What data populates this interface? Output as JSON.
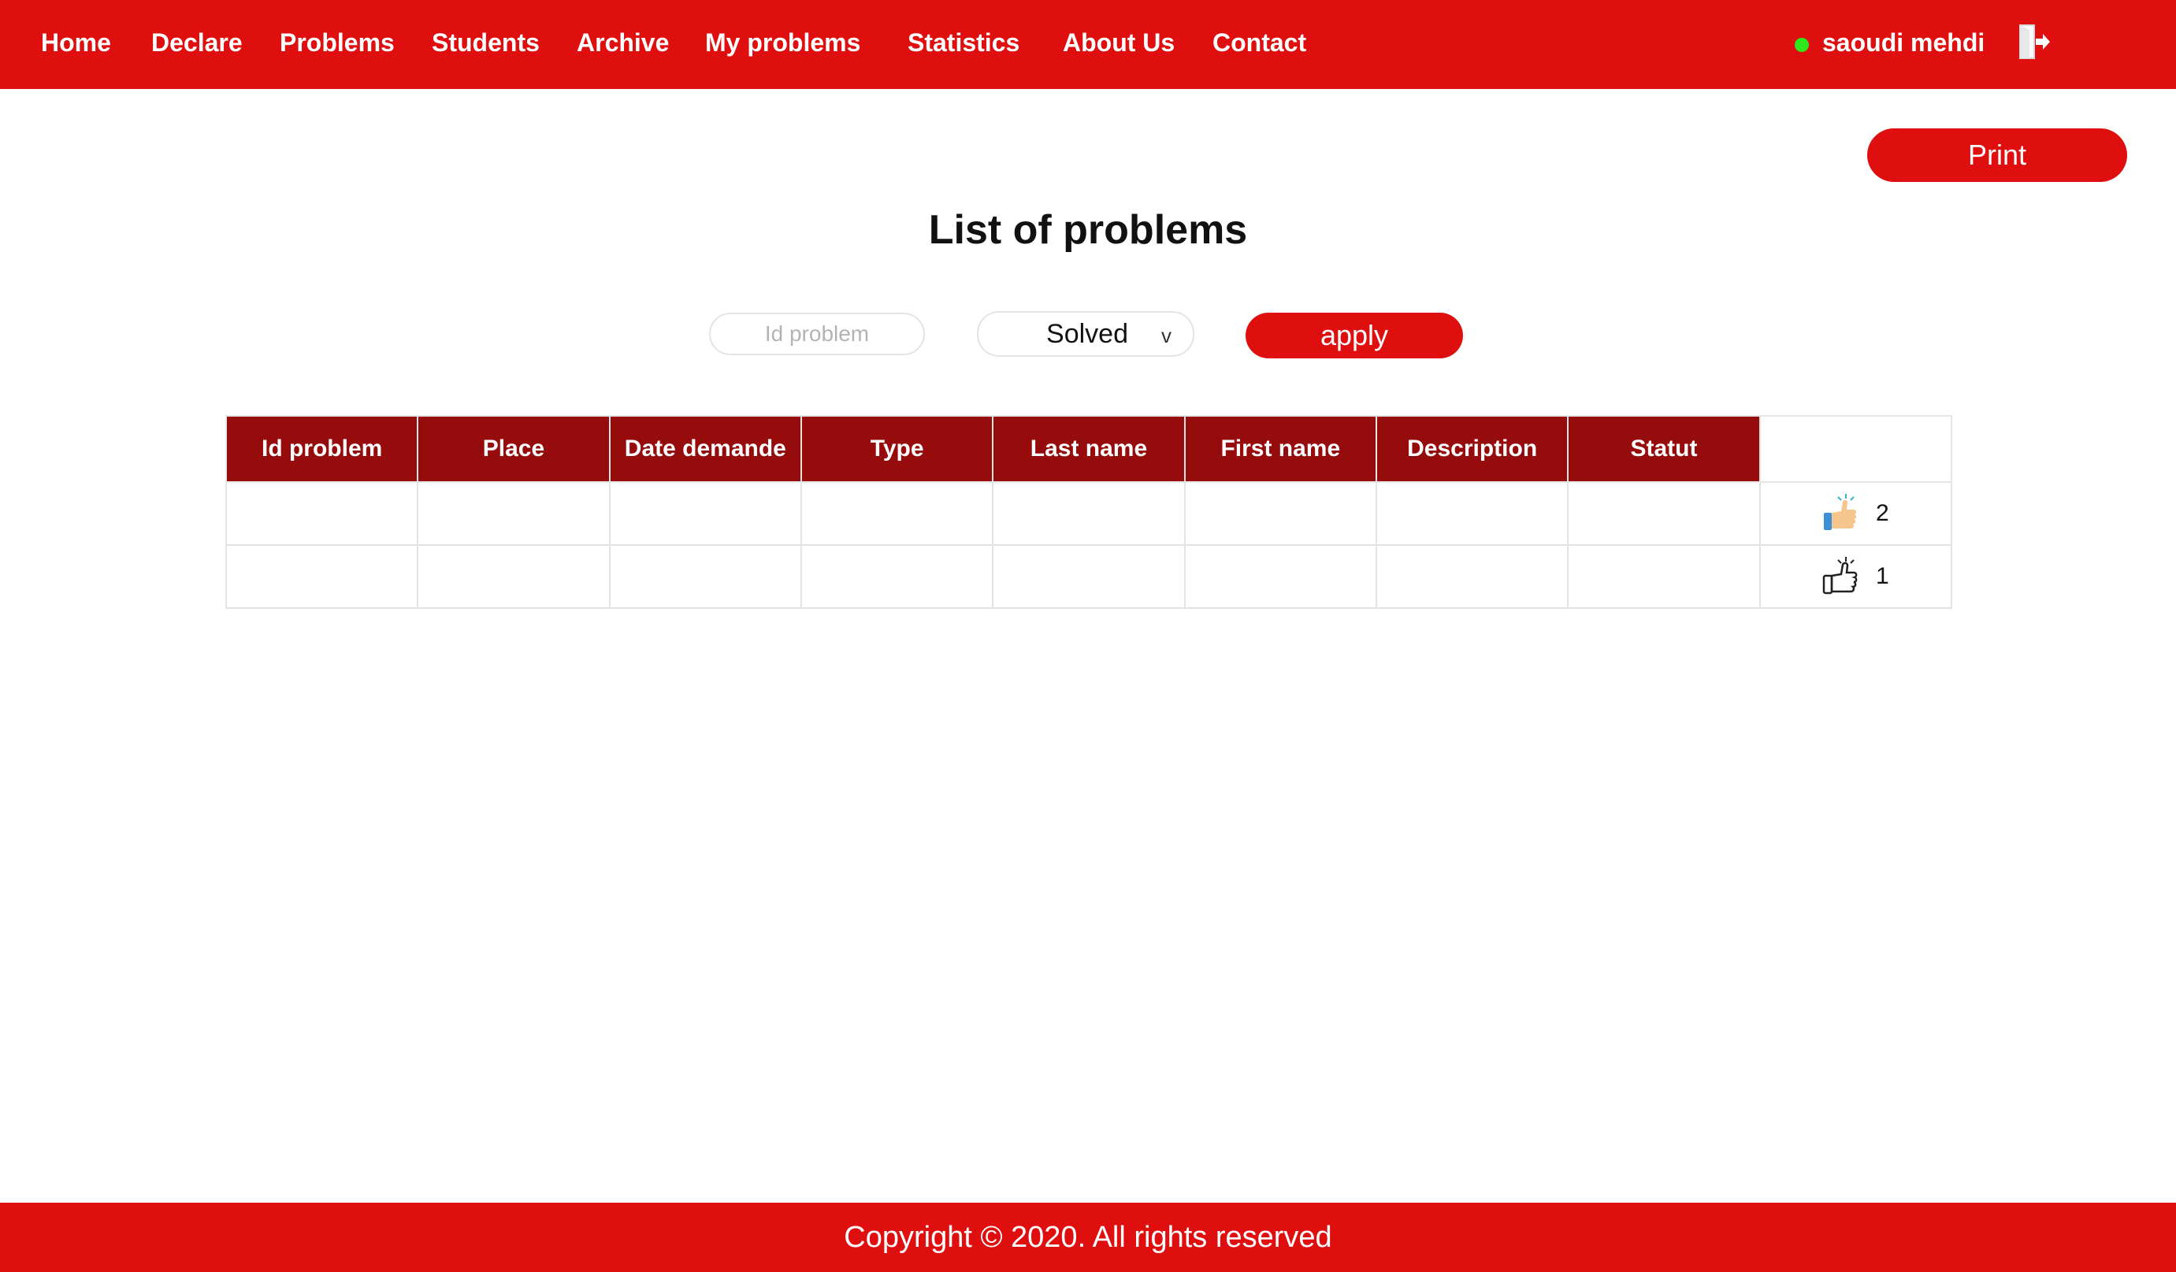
{
  "nav": {
    "items": [
      "Home",
      "Declare",
      "Problems",
      "Students",
      "Archive",
      "My problems",
      "Statistics",
      "About Us",
      "Contact"
    ],
    "user_name": "saoudi mehdi",
    "online_color": "#2ee81e",
    "logout_icon": "logout-icon"
  },
  "toolbar": {
    "print_label": "Print"
  },
  "page": {
    "title": "List of problems"
  },
  "filter": {
    "id_placeholder": "Id problem",
    "status_selected": "Solved",
    "apply_label": "apply"
  },
  "table": {
    "columns": [
      "Id problem",
      "Place",
      "Date demande",
      "Type",
      "Last name",
      "First name",
      "Description",
      "Statut"
    ],
    "rows": [
      {
        "cells": [
          "",
          "",
          "",
          "",
          "",
          "",
          "",
          ""
        ],
        "vote_icon": "thumbs-up-colored-icon",
        "vote_count": "2"
      },
      {
        "cells": [
          "",
          "",
          "",
          "",
          "",
          "",
          "",
          ""
        ],
        "vote_icon": "thumbs-up-outline-icon",
        "vote_count": "1"
      }
    ]
  },
  "footer": {
    "text": "Copyright © 2020. All rights reserved"
  },
  "colors": {
    "brand_red": "#e00f0f",
    "header_dark_red": "#960b0b"
  }
}
